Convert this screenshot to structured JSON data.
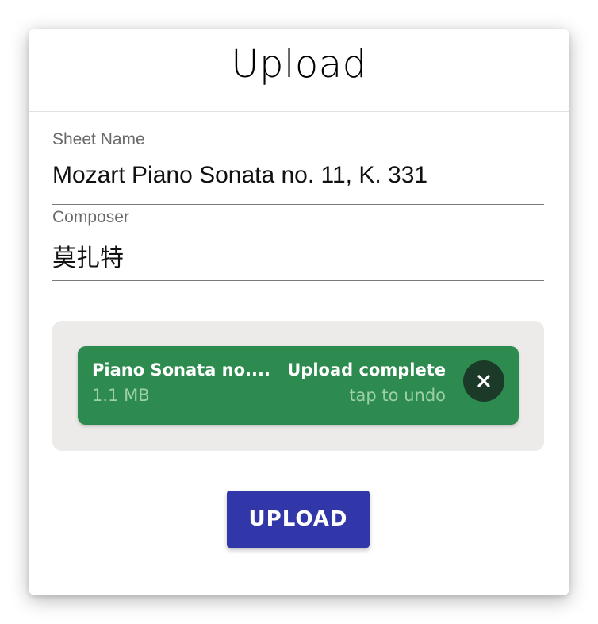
{
  "dialog": {
    "title": "Upload"
  },
  "form": {
    "sheet_name": {
      "label": "Sheet Name",
      "value": "Mozart Piano Sonata no. 11, K. 331"
    },
    "composer": {
      "label": "Composer",
      "value": "莫扎特"
    }
  },
  "file_item": {
    "name": "Piano Sonata no....",
    "size": "1.1 MB",
    "status": "Upload complete",
    "hint": "tap to undo",
    "remove_icon": "close-icon"
  },
  "actions": {
    "upload_label": "UPLOAD"
  },
  "colors": {
    "accent": "#3136a8",
    "success": "#2e8b4f",
    "success_muted": "#9ed0a6",
    "drop_zone_bg": "#edebe9"
  }
}
